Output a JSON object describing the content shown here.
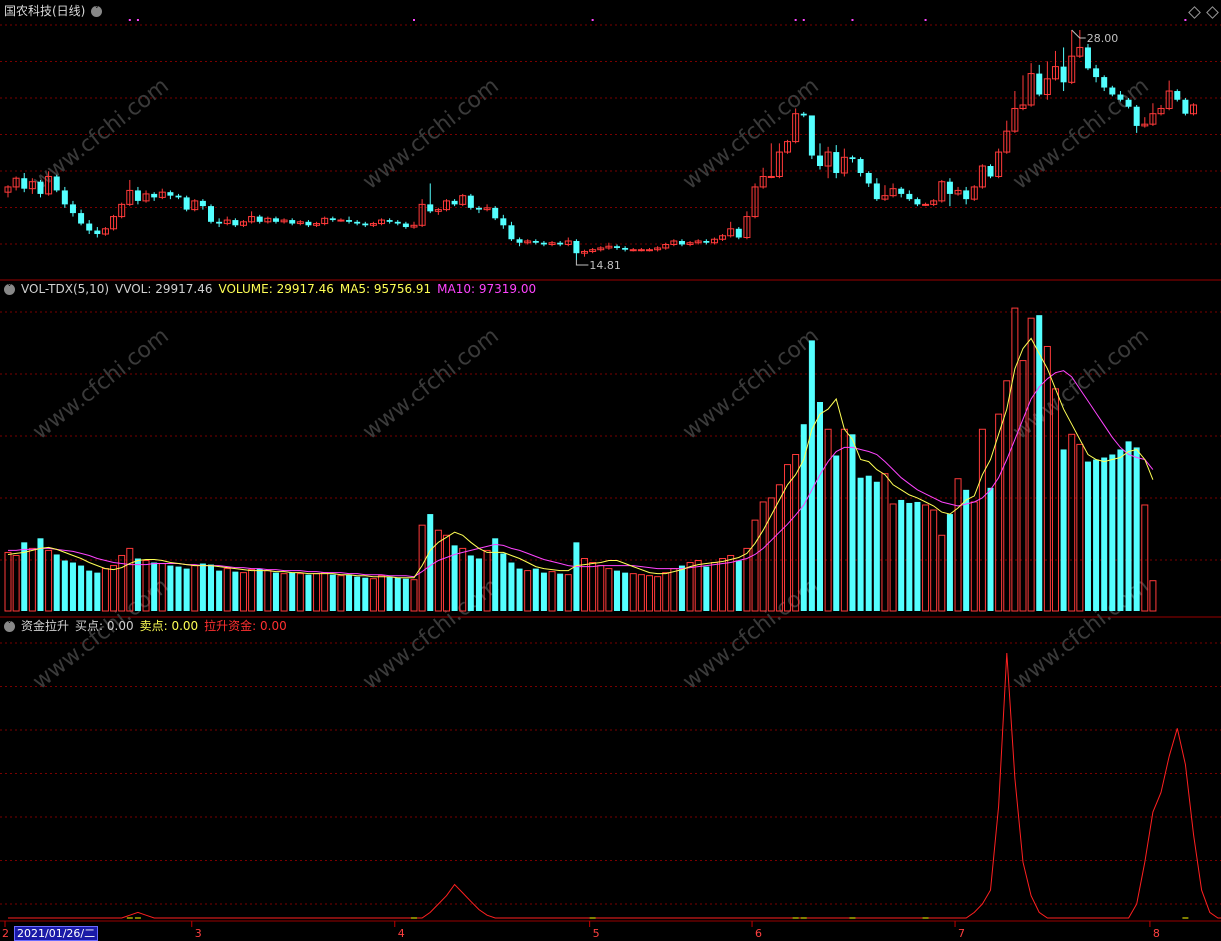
{
  "panels": {
    "price": {
      "title": "国农科技(日线)",
      "high_label": "28.00",
      "low_label": "14.81"
    },
    "volume": {
      "indicator": "VOL-TDX(5,10)",
      "vvol": "VVOL: 29917.46",
      "volume": "VOLUME: 29917.46",
      "ma5": "MA5: 95756.91",
      "ma10": "MA10: 97319.00"
    },
    "fund": {
      "indicator": "资金拉升",
      "buy": "买点: 0.00",
      "sell": "卖点: 0.00",
      "pull": "拉升资金: 0.00"
    }
  },
  "axis": {
    "selected_date": "2021/01/26/二",
    "first_tick": "2",
    "month_ticks": [
      "3",
      "4",
      "5",
      "6",
      "7",
      "8"
    ]
  },
  "watermark": "www.cfchi.com",
  "colors": {
    "up": "#ff3a3a",
    "down": "#54ffff",
    "ma5": "#ffff55",
    "ma10": "#ff44ff",
    "grid": "#7a0000",
    "fund_line": "#ff2020",
    "fund_sell": "#ffff00"
  },
  "chart_data": {
    "type": "candlestick+bar+line",
    "price_range": [
      14.81,
      28.0
    ],
    "candles": [
      [
        18.7,
        19.0,
        18.4,
        19.1
      ],
      [
        19.0,
        19.5,
        18.8,
        19.6
      ],
      [
        19.5,
        18.9,
        18.7,
        19.8
      ],
      [
        18.9,
        19.3,
        18.6,
        19.5
      ],
      [
        19.3,
        18.6,
        18.4,
        19.4
      ],
      [
        18.6,
        19.6,
        18.5,
        19.9
      ],
      [
        19.6,
        18.8,
        18.7,
        19.7
      ],
      [
        18.8,
        18.0,
        17.8,
        19.0
      ],
      [
        18.0,
        17.5,
        17.3,
        18.2
      ],
      [
        17.5,
        16.9,
        16.8,
        17.7
      ],
      [
        16.9,
        16.5,
        16.3,
        17.1
      ],
      [
        16.5,
        16.3,
        16.1,
        16.7
      ],
      [
        16.3,
        16.6,
        16.2,
        16.7
      ],
      [
        16.6,
        17.3,
        16.5,
        17.4
      ],
      [
        17.3,
        18.0,
        17.2,
        18.1
      ],
      [
        18.0,
        18.8,
        17.9,
        19.4
      ],
      [
        18.8,
        18.2,
        18.0,
        19.0
      ],
      [
        18.2,
        18.6,
        18.1,
        18.8
      ],
      [
        18.6,
        18.4,
        18.2,
        18.7
      ],
      [
        18.4,
        18.7,
        18.3,
        18.9
      ],
      [
        18.7,
        18.5,
        18.3,
        18.8
      ],
      [
        18.5,
        18.4,
        18.3,
        18.6
      ],
      [
        18.4,
        17.7,
        17.6,
        18.5
      ],
      [
        17.7,
        18.2,
        17.6,
        18.3
      ],
      [
        18.2,
        17.9,
        17.7,
        18.3
      ],
      [
        17.9,
        17.0,
        16.9,
        18.0
      ],
      [
        17.0,
        16.9,
        16.7,
        17.2
      ],
      [
        16.9,
        17.1,
        16.8,
        17.3
      ],
      [
        17.1,
        16.8,
        16.7,
        17.2
      ],
      [
        16.8,
        17.0,
        16.7,
        17.1
      ],
      [
        17.0,
        17.3,
        16.9,
        17.6
      ],
      [
        17.3,
        17.0,
        16.9,
        17.4
      ],
      [
        17.0,
        17.2,
        16.9,
        17.3
      ],
      [
        17.2,
        17.0,
        16.9,
        17.3
      ],
      [
        17.0,
        17.1,
        16.9,
        17.2
      ],
      [
        17.1,
        16.9,
        16.8,
        17.2
      ],
      [
        16.9,
        17.0,
        16.8,
        17.1
      ],
      [
        17.0,
        16.8,
        16.7,
        17.1
      ],
      [
        16.8,
        16.9,
        16.7,
        17.0
      ],
      [
        16.9,
        17.2,
        16.8,
        17.3
      ],
      [
        17.2,
        17.1,
        17.0,
        17.3
      ],
      [
        17.1,
        17.1,
        17.0,
        17.2
      ],
      [
        17.1,
        17.0,
        16.9,
        17.3
      ],
      [
        17.0,
        16.9,
        16.8,
        17.1
      ],
      [
        16.9,
        16.8,
        16.7,
        17.0
      ],
      [
        16.8,
        16.9,
        16.7,
        17.0
      ],
      [
        16.9,
        17.1,
        16.8,
        17.2
      ],
      [
        17.1,
        17.0,
        16.9,
        17.2
      ],
      [
        17.0,
        16.9,
        16.8,
        17.1
      ],
      [
        16.9,
        16.7,
        16.6,
        17.0
      ],
      [
        16.7,
        16.8,
        16.6,
        17.0
      ],
      [
        16.8,
        18.0,
        16.7,
        18.3
      ],
      [
        18.0,
        17.6,
        17.5,
        19.2
      ],
      [
        17.6,
        17.7,
        17.4,
        17.8
      ],
      [
        17.7,
        18.2,
        17.6,
        18.3
      ],
      [
        18.2,
        18.0,
        17.9,
        18.3
      ],
      [
        18.0,
        18.5,
        17.9,
        18.6
      ],
      [
        18.5,
        17.8,
        17.7,
        18.6
      ],
      [
        17.8,
        17.7,
        17.5,
        17.9
      ],
      [
        17.7,
        17.8,
        17.6,
        18.0
      ],
      [
        17.8,
        17.2,
        17.1,
        17.9
      ],
      [
        17.2,
        16.8,
        16.6,
        17.4
      ],
      [
        16.8,
        16.0,
        15.9,
        17.0
      ],
      [
        16.0,
        15.8,
        15.6,
        16.1
      ],
      [
        15.8,
        15.9,
        15.7,
        16.0
      ],
      [
        15.9,
        15.8,
        15.7,
        16.0
      ],
      [
        15.8,
        15.7,
        15.6,
        15.9
      ],
      [
        15.7,
        15.8,
        15.6,
        15.9
      ],
      [
        15.8,
        15.7,
        15.6,
        15.9
      ],
      [
        15.7,
        15.9,
        15.6,
        16.1
      ],
      [
        15.9,
        15.2,
        14.81,
        16.0
      ],
      [
        15.2,
        15.3,
        15.0,
        15.4
      ],
      [
        15.3,
        15.4,
        15.2,
        15.5
      ],
      [
        15.4,
        15.5,
        15.3,
        15.6
      ],
      [
        15.5,
        15.6,
        15.4,
        15.8
      ],
      [
        15.6,
        15.5,
        15.4,
        15.7
      ],
      [
        15.5,
        15.4,
        15.3,
        15.6
      ],
      [
        15.4,
        15.4,
        15.3,
        15.5
      ],
      [
        15.4,
        15.4,
        15.3,
        15.5
      ],
      [
        15.4,
        15.4,
        15.3,
        15.5
      ],
      [
        15.4,
        15.5,
        15.3,
        15.6
      ],
      [
        15.5,
        15.7,
        15.4,
        15.8
      ],
      [
        15.7,
        15.9,
        15.6,
        16.0
      ],
      [
        15.9,
        15.7,
        15.6,
        16.0
      ],
      [
        15.7,
        15.8,
        15.6,
        15.9
      ],
      [
        15.8,
        15.9,
        15.7,
        16.0
      ],
      [
        15.9,
        15.8,
        15.7,
        16.0
      ],
      [
        15.8,
        16.0,
        15.7,
        16.1
      ],
      [
        16.0,
        16.2,
        15.9,
        16.3
      ],
      [
        16.2,
        16.6,
        16.1,
        17.0
      ],
      [
        16.6,
        16.1,
        16.0,
        16.7
      ],
      [
        16.1,
        17.3,
        16.0,
        17.6
      ],
      [
        17.3,
        19.0,
        17.2,
        19.2
      ],
      [
        19.0,
        19.6,
        18.9,
        20.1
      ],
      [
        19.6,
        19.6,
        19.5,
        21.5
      ],
      [
        19.6,
        21.0,
        19.5,
        21.5
      ],
      [
        21.0,
        21.6,
        20.9,
        21.7
      ],
      [
        21.6,
        23.2,
        21.5,
        23.5
      ],
      [
        23.2,
        23.1,
        23.0,
        23.3
      ],
      [
        23.1,
        20.8,
        20.6,
        22.5
      ],
      [
        20.8,
        20.2,
        20.0,
        21.5
      ],
      [
        20.2,
        21.0,
        19.5,
        21.3
      ],
      [
        21.0,
        19.8,
        19.5,
        21.4
      ],
      [
        19.8,
        20.7,
        19.6,
        21.2
      ],
      [
        20.7,
        20.6,
        20.4,
        20.8
      ],
      [
        20.6,
        19.8,
        19.6,
        20.7
      ],
      [
        19.8,
        19.2,
        19.0,
        19.9
      ],
      [
        19.2,
        18.3,
        18.2,
        19.5
      ],
      [
        18.3,
        18.5,
        18.2,
        19.1
      ],
      [
        18.5,
        18.9,
        18.4,
        19.2
      ],
      [
        18.9,
        18.6,
        18.4,
        19.0
      ],
      [
        18.6,
        18.3,
        18.2,
        18.8
      ],
      [
        18.3,
        18.0,
        17.9,
        18.4
      ],
      [
        18.0,
        18.0,
        17.9,
        18.1
      ],
      [
        18.0,
        18.2,
        17.9,
        18.3
      ],
      [
        18.2,
        19.3,
        18.1,
        19.4
      ],
      [
        19.3,
        18.6,
        17.9,
        19.5
      ],
      [
        18.6,
        18.8,
        18.5,
        19.0
      ],
      [
        18.8,
        18.3,
        18.0,
        19.0
      ],
      [
        18.3,
        19.0,
        18.2,
        19.1
      ],
      [
        19.0,
        20.2,
        18.9,
        20.3
      ],
      [
        20.2,
        19.6,
        19.5,
        20.3
      ],
      [
        19.6,
        21.0,
        19.5,
        21.2
      ],
      [
        21.0,
        22.2,
        20.9,
        22.8
      ],
      [
        22.2,
        23.5,
        22.1,
        24.5
      ],
      [
        23.5,
        23.7,
        23.4,
        25.4
      ],
      [
        23.7,
        25.5,
        23.6,
        26.1
      ],
      [
        25.5,
        24.3,
        24.2,
        26.0
      ],
      [
        24.3,
        25.2,
        24.0,
        26.2
      ],
      [
        25.2,
        25.9,
        25.1,
        26.8
      ],
      [
        25.9,
        25.0,
        24.5,
        27.0
      ],
      [
        25.0,
        26.5,
        24.9,
        28.0
      ],
      [
        26.5,
        27.0,
        26.4,
        28.0
      ],
      [
        27.0,
        25.8,
        25.7,
        27.2
      ],
      [
        25.8,
        25.3,
        25.0,
        26.0
      ],
      [
        25.3,
        24.7,
        24.5,
        25.4
      ],
      [
        24.7,
        24.3,
        24.2,
        24.8
      ],
      [
        24.3,
        24.0,
        23.9,
        24.5
      ],
      [
        24.0,
        23.6,
        23.5,
        24.1
      ],
      [
        23.6,
        22.5,
        22.1,
        23.7
      ],
      [
        22.5,
        22.6,
        22.4,
        23.0
      ],
      [
        22.6,
        23.2,
        22.5,
        23.8
      ],
      [
        23.2,
        23.5,
        23.1,
        23.7
      ],
      [
        23.5,
        24.5,
        23.4,
        25.1
      ],
      [
        24.5,
        24.0,
        23.9,
        24.6
      ],
      [
        24.0,
        23.2,
        23.1,
        24.1
      ],
      [
        23.2,
        23.7,
        23.1,
        23.8
      ]
    ],
    "vol_range": [
      0,
      310000
    ],
    "volume": [
      58000,
      55000,
      68000,
      62000,
      72000,
      60000,
      56000,
      50000,
      48000,
      45000,
      40000,
      38000,
      42000,
      45000,
      55000,
      62000,
      52000,
      50000,
      48000,
      47000,
      45000,
      44000,
      42000,
      45000,
      47000,
      46000,
      40000,
      42000,
      39000,
      38000,
      41000,
      42000,
      40000,
      38000,
      37000,
      38000,
      37000,
      36000,
      37000,
      38000,
      36000,
      35000,
      36000,
      34000,
      33000,
      32000,
      35000,
      34000,
      33000,
      32000,
      31000,
      85000,
      96000,
      80000,
      75000,
      65000,
      62000,
      55000,
      52000,
      60000,
      72000,
      57000,
      48000,
      42000,
      40000,
      42000,
      38000,
      39000,
      37000,
      36000,
      68000,
      52000,
      48000,
      45000,
      42000,
      40000,
      38000,
      37000,
      36000,
      35000,
      34000,
      38000,
      42000,
      45000,
      48000,
      50000,
      44000,
      48000,
      52000,
      55000,
      50000,
      62000,
      90000,
      108000,
      112000,
      125000,
      145000,
      155000,
      185000,
      268000,
      207000,
      180000,
      154000,
      180000,
      175000,
      132000,
      134000,
      128000,
      136000,
      106000,
      110000,
      107000,
      108000,
      105000,
      100000,
      75000,
      96000,
      131000,
      120000,
      108000,
      180000,
      122000,
      195000,
      228000,
      300000,
      248000,
      290000,
      293000,
      262000,
      220000,
      160000,
      175000,
      165000,
      148000,
      150000,
      152000,
      155000,
      160000,
      168000,
      162000,
      105000,
      30000
    ],
    "ma5": [
      56000,
      57000,
      58000,
      60000,
      62000,
      63000,
      61000,
      58000,
      55000,
      52000,
      48000,
      45000,
      42000,
      41000,
      43000,
      47000,
      50000,
      51000,
      51000,
      50000,
      48000,
      47000,
      46000,
      45000,
      45000,
      45000,
      44000,
      43000,
      42000,
      41000,
      40000,
      40000,
      40000,
      39000,
      39000,
      38000,
      38000,
      37000,
      37000,
      37000,
      37000,
      36000,
      36000,
      35000,
      35000,
      34000,
      34000,
      34000,
      33000,
      33000,
      33000,
      45000,
      60000,
      68000,
      73000,
      78000,
      75000,
      68000,
      62000,
      58000,
      58000,
      58000,
      55000,
      52000,
      48000,
      44000,
      42000,
      41000,
      40000,
      40000,
      45000,
      46000,
      47000,
      48000,
      50000,
      50000,
      47000,
      44000,
      41000,
      38000,
      37000,
      37000,
      39000,
      41000,
      44000,
      46000,
      47000,
      48000,
      49000,
      51000,
      53000,
      57000,
      67000,
      80000,
      95000,
      110000,
      125000,
      135000,
      150000,
      180000,
      195000,
      200000,
      210000,
      180000,
      170000,
      150000,
      148000,
      140000,
      135000,
      125000,
      120000,
      115000,
      112000,
      108000,
      104000,
      98000,
      96000,
      102000,
      110000,
      114000,
      135000,
      150000,
      175000,
      200000,
      240000,
      260000,
      270000,
      255000,
      240000,
      220000,
      200000,
      185000,
      170000,
      155000,
      150000,
      148000,
      150000,
      152000,
      158000,
      160000,
      150000,
      130000
    ],
    "ma10": [
      60000,
      60000,
      61000,
      61000,
      62000,
      62000,
      61000,
      60000,
      59000,
      57000,
      55000,
      52000,
      50000,
      48000,
      47000,
      46000,
      46000,
      46000,
      47000,
      47000,
      47000,
      47000,
      46000,
      46000,
      45000,
      45000,
      45000,
      44000,
      43000,
      43000,
      42000,
      42000,
      41000,
      41000,
      40000,
      40000,
      40000,
      39000,
      39000,
      38000,
      38000,
      38000,
      37000,
      37000,
      36000,
      36000,
      36000,
      35000,
      35000,
      35000,
      34000,
      39000,
      45000,
      50000,
      53000,
      56000,
      58000,
      60000,
      62000,
      64000,
      66000,
      65000,
      62000,
      60000,
      57000,
      54000,
      51000,
      49000,
      47000,
      45000,
      44000,
      44000,
      44000,
      45000,
      45000,
      45000,
      45000,
      45000,
      44000,
      43000,
      42000,
      42000,
      42000,
      42000,
      43000,
      44000,
      45000,
      46000,
      47000,
      48000,
      50000,
      52000,
      56000,
      62000,
      70000,
      78000,
      86000,
      95000,
      105000,
      120000,
      135000,
      148000,
      158000,
      162000,
      162000,
      160000,
      158000,
      155000,
      148000,
      140000,
      132000,
      126000,
      120000,
      116000,
      112000,
      108000,
      106000,
      104000,
      106000,
      108000,
      112000,
      120000,
      132000,
      150000,
      170000,
      190000,
      210000,
      222000,
      230000,
      236000,
      238000,
      232000,
      220000,
      208000,
      196000,
      184000,
      172000,
      162000,
      155000,
      152000,
      150000,
      140000
    ],
    "fund_range": [
      0,
      100
    ],
    "fund_pull": [
      0,
      0,
      0,
      0,
      0,
      0,
      0,
      0,
      0,
      0,
      0,
      0,
      0,
      0,
      0,
      1,
      2,
      1,
      0,
      0,
      0,
      0,
      0,
      0,
      0,
      0,
      0,
      0,
      0,
      0,
      0,
      0,
      0,
      0,
      0,
      0,
      0,
      0,
      0,
      0,
      0,
      0,
      0,
      0,
      0,
      0,
      0,
      0,
      0,
      0,
      0,
      0,
      2,
      5,
      8,
      12,
      9,
      6,
      3,
      1,
      0,
      0,
      0,
      0,
      0,
      0,
      0,
      0,
      0,
      0,
      0,
      0,
      0,
      0,
      0,
      0,
      0,
      0,
      0,
      0,
      0,
      0,
      0,
      0,
      0,
      0,
      0,
      0,
      0,
      0,
      0,
      0,
      0,
      0,
      0,
      0,
      0,
      0,
      0,
      0,
      0,
      0,
      0,
      0,
      0,
      0,
      0,
      0,
      0,
      0,
      0,
      0,
      0,
      0,
      0,
      0,
      0,
      0,
      0,
      2,
      5,
      10,
      40,
      95,
      50,
      20,
      8,
      2,
      0,
      0,
      0,
      0,
      0,
      0,
      0,
      0,
      0,
      0,
      0,
      5,
      20,
      38,
      45,
      58,
      68,
      55,
      30,
      10,
      2,
      0,
      0,
      0,
      0,
      0,
      0,
      0,
      0,
      0,
      0,
      0,
      0,
      0
    ],
    "fund_sell_flags": [
      15,
      16,
      50,
      72,
      97,
      98,
      104,
      113,
      145
    ]
  }
}
